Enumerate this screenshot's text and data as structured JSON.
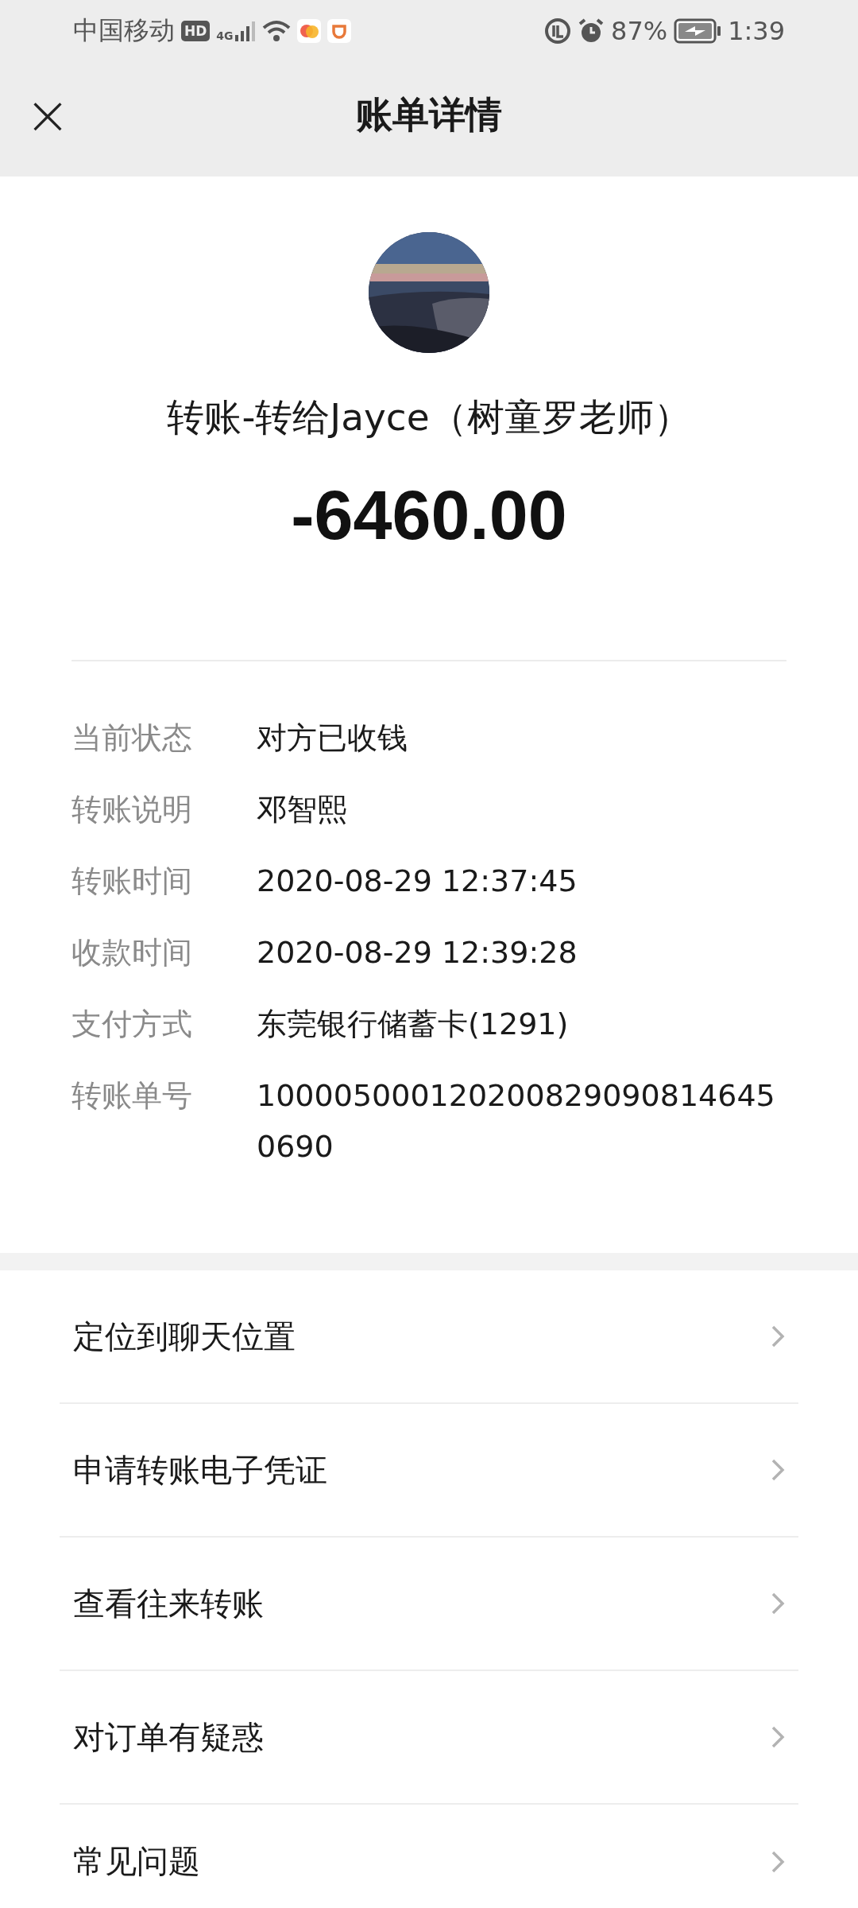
{
  "status_bar": {
    "carrier": "中国移动",
    "hd": "HD",
    "network": "4G",
    "battery": "87%",
    "time": "1:39"
  },
  "header": {
    "close": "×",
    "title": "账单详情"
  },
  "summary": {
    "payee": "转账-转给Jayce（树童罗老师）",
    "amount": "-6460.00"
  },
  "details": [
    {
      "label": "当前状态",
      "value": "对方已收钱"
    },
    {
      "label": "转账说明",
      "value": "邓智熙"
    },
    {
      "label": "转账时间",
      "value": "2020-08-29 12:37:45"
    },
    {
      "label": "收款时间",
      "value": "2020-08-29 12:39:28"
    },
    {
      "label": "支付方式",
      "value": "东莞银行储蓄卡(1291)"
    },
    {
      "label": "转账单号",
      "value": "1000050001202008290908146450690"
    }
  ],
  "menu": [
    {
      "label": "定位到聊天位置"
    },
    {
      "label": "申请转账电子凭证"
    },
    {
      "label": "查看往来转账"
    },
    {
      "label": "对订单有疑惑"
    },
    {
      "label": "常见问题"
    }
  ]
}
